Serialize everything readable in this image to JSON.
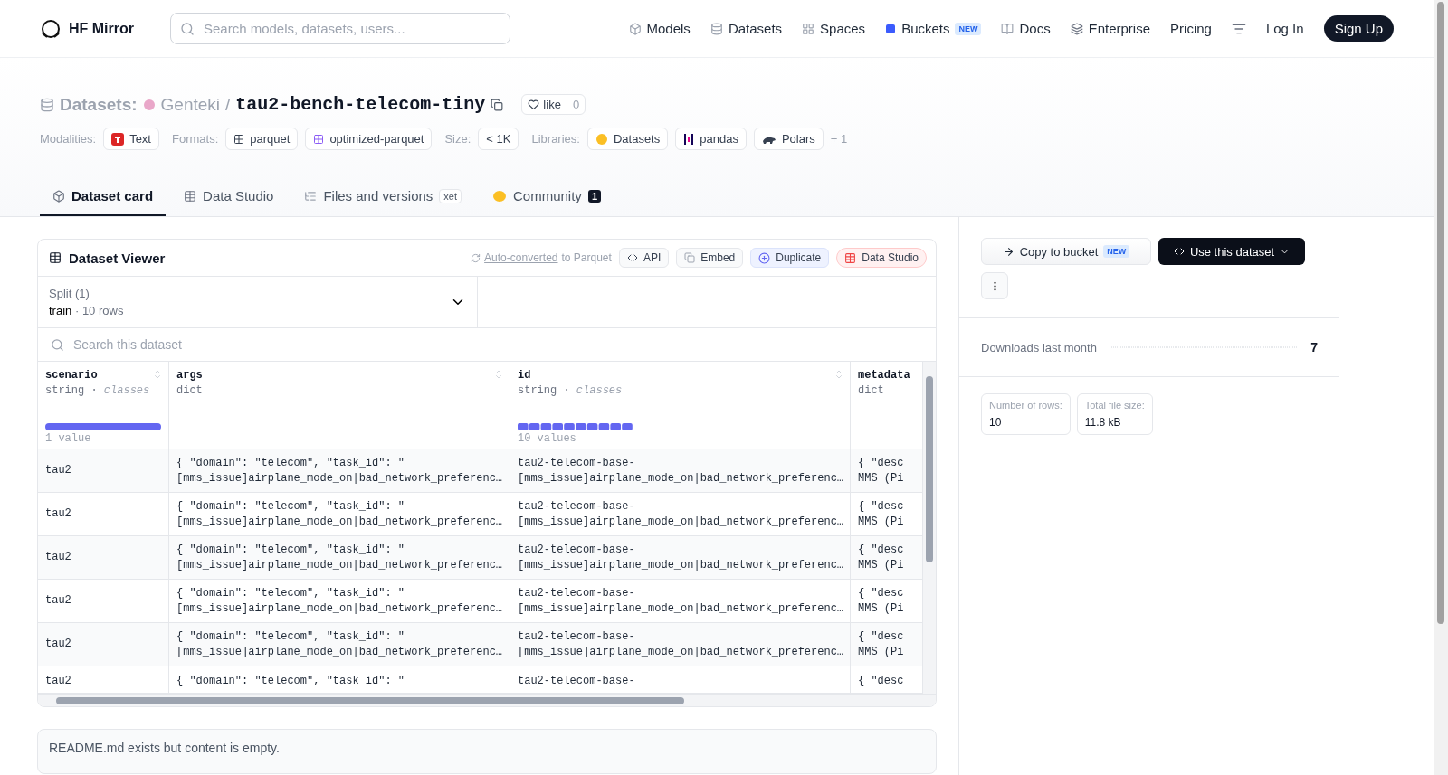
{
  "header": {
    "brand": "HF Mirror",
    "search": {
      "placeholder": "Search models, datasets, users..."
    },
    "nav": [
      {
        "label": "Models"
      },
      {
        "label": "Datasets"
      },
      {
        "label": "Spaces"
      },
      {
        "label": "Buckets",
        "badge": "NEW"
      },
      {
        "label": "Docs"
      },
      {
        "label": "Enterprise"
      },
      {
        "label": "Pricing"
      }
    ],
    "login": "Log In",
    "signup": "Sign Up"
  },
  "repo": {
    "type": "Datasets:",
    "owner": "Genteki",
    "separator": "/",
    "name": "tau2-bench-telecom-tiny",
    "like": "like",
    "likes": "0"
  },
  "meta": [
    {
      "label": "Modalities:",
      "tags": [
        {
          "text": "Text"
        }
      ]
    },
    {
      "label": "Formats:",
      "tags": [
        {
          "text": "parquet"
        },
        {
          "text": "optimized-parquet"
        }
      ]
    },
    {
      "label": "Size:",
      "tags": [
        {
          "text": "< 1K"
        }
      ]
    },
    {
      "label": "Libraries:",
      "tags": [
        {
          "text": "Datasets"
        },
        {
          "text": "pandas"
        },
        {
          "text": "Polars"
        }
      ],
      "more": "+ 1"
    }
  ],
  "tabs": [
    {
      "label": "Dataset card",
      "selected": true
    },
    {
      "label": "Data Studio",
      "selected": false
    },
    {
      "label": "Files and versions",
      "badge": "xet",
      "selected": false
    },
    {
      "label": "Community",
      "count": "1",
      "selected": false
    }
  ],
  "viewer": {
    "title": "Dataset Viewer",
    "auto_link": "Auto-converted",
    "auto_rest": "to Parquet",
    "actions": [
      {
        "label": "API",
        "kind": "api"
      },
      {
        "label": "Embed",
        "kind": "embed"
      },
      {
        "label": "Duplicate",
        "kind": "duplicate"
      },
      {
        "label": "Data Studio",
        "kind": "studio"
      }
    ],
    "split": {
      "label": "Split (1)",
      "name": "train",
      "dot": "·",
      "rows": "10 rows"
    },
    "search": {
      "placeholder": "Search this dataset"
    },
    "columns": [
      {
        "kind": "single",
        "name": "scenario",
        "type": "string",
        "dot": "·",
        "extra": "classes",
        "values": "1 value"
      },
      {
        "kind": "plain",
        "name": "args",
        "type": "dict"
      },
      {
        "kind": "segmented",
        "name": "id",
        "type": "string",
        "dot": "·",
        "extra": "classes",
        "values": "10 values"
      },
      {
        "kind": "plain",
        "name": "metadata",
        "type": "dict"
      }
    ],
    "rows": [
      {
        "cells": [
          "tau2",
          "{ \"domain\": \"telecom\", \"task_id\": \"\n[mms_issue]airplane_mode_on|bad_network_preferenc…",
          "tau2-telecom-base-\n[mms_issue]airplane_mode_on|bad_network_preferenc…",
          "{ \"desc\nMMS (Pi"
        ]
      },
      {
        "cells": [
          "tau2",
          "{ \"domain\": \"telecom\", \"task_id\": \"\n[mms_issue]airplane_mode_on|bad_network_preferenc…",
          "tau2-telecom-base-\n[mms_issue]airplane_mode_on|bad_network_preferenc…",
          "{ \"desc\nMMS (Pi"
        ]
      },
      {
        "cells": [
          "tau2",
          "{ \"domain\": \"telecom\", \"task_id\": \"\n[mms_issue]airplane_mode_on|bad_network_preferenc…",
          "tau2-telecom-base-\n[mms_issue]airplane_mode_on|bad_network_preferenc…",
          "{ \"desc\nMMS (Pi"
        ]
      },
      {
        "cells": [
          "tau2",
          "{ \"domain\": \"telecom\", \"task_id\": \"\n[mms_issue]airplane_mode_on|bad_network_preferenc…",
          "tau2-telecom-base-\n[mms_issue]airplane_mode_on|bad_network_preferenc…",
          "{ \"desc\nMMS (Pi"
        ]
      },
      {
        "cells": [
          "tau2",
          "{ \"domain\": \"telecom\", \"task_id\": \"\n[mms_issue]airplane_mode_on|bad_network_preferenc…",
          "tau2-telecom-base-\n[mms_issue]airplane_mode_on|bad_network_preferenc…",
          "{ \"desc\nMMS (Pi"
        ]
      },
      {
        "cells": [
          "tau2",
          "{ \"domain\": \"telecom\", \"task_id\": \"",
          "tau2-telecom-base-",
          "{ \"desc"
        ]
      }
    ]
  },
  "readme": "README.md exists but content is empty.",
  "sidebar": {
    "copy": "Copy to bucket",
    "copy_badge": "NEW",
    "use": "Use this dataset",
    "downloads_label": "Downloads last month",
    "downloads": "7",
    "stats": [
      {
        "label": "Number of rows:",
        "value": "10"
      },
      {
        "label": "Total file size:",
        "value": "11.8 kB"
      }
    ]
  }
}
